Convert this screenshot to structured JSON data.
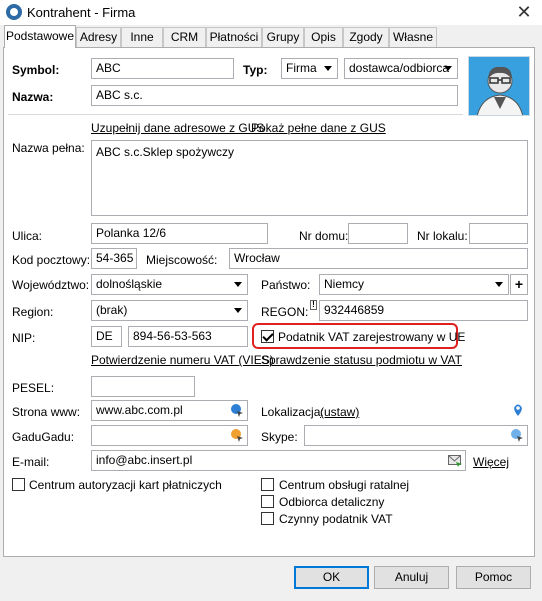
{
  "window": {
    "title": "Kontrahent - Firma",
    "close_glyph": "✕"
  },
  "tabs": [
    {
      "label": "Podstawowe"
    },
    {
      "label": "Adresy"
    },
    {
      "label": "Inne"
    },
    {
      "label": "CRM"
    },
    {
      "label": "Płatności"
    },
    {
      "label": "Grupy"
    },
    {
      "label": "Opis"
    },
    {
      "label": "Zgody"
    },
    {
      "label": "Własne"
    }
  ],
  "form": {
    "symbol_label": "Symbol:",
    "symbol_value": "ABC",
    "typ_label": "Typ:",
    "typ_value": "Firma",
    "relation_value": "dostawca/odbiorca",
    "nazwa_label": "Nazwa:",
    "nazwa_value": "ABC s.c.",
    "gus_link": "Uzupełnij dane adresowe z GUS",
    "gus_full_link": "Pokaż pełne dane z GUS",
    "pelna_label": "Nazwa pełna:",
    "pelna_value": "ABC s.c.Sklep spożywczy",
    "ulica_label": "Ulica:",
    "ulica_value": "Polanka  12/6",
    "nrdomu_label": "Nr domu:",
    "nrdomu_value": "",
    "nrlokalu_label": "Nr lokalu:",
    "nrlokalu_value": "",
    "kod_label": "Kod pocztowy:",
    "kod_value": "54-365",
    "miejsc_label": "Miejscowość:",
    "miejsc_value": "Wrocław",
    "woj_label": "Województwo:",
    "woj_value": "dolnośląskie",
    "panstwo_label": "Państwo:",
    "panstwo_value": "Niemcy",
    "panstwo_add": "+",
    "region_label": "Region:",
    "region_value": "(brak)",
    "regon_label": "REGON:",
    "regon_value": "932446859",
    "regon_marker": "!",
    "nip_label": "NIP:",
    "nip_prefix": "DE",
    "nip_value": "894-56-53-563",
    "vat_ue_label": "Podatnik VAT zarejestrowany w UE",
    "vies_link": "Potwierdzenie numeru VAT (VIES)",
    "status_link": "Sprawdzenie statusu podmiotu w VAT",
    "pesel_label": "PESEL:",
    "pesel_value": "",
    "www_label": "Strona www:",
    "www_value": "www.abc.com.pl",
    "lokalizacja_label": "Lokalizacja:",
    "lokalizacja_link": "(ustaw)",
    "gadu_label": "GaduGadu:",
    "gadu_value": "",
    "skype_label": "Skype:",
    "skype_value": "",
    "email_label": "E-mail:",
    "email_value": "info@abc.insert.pl",
    "wiecej_link": "Więcej"
  },
  "checkboxes": {
    "centrum_autoryzacji": {
      "label": "Centrum autoryzacji kart płatniczych",
      "checked": false
    },
    "centrum_obslugi": {
      "label": "Centrum obsługi ratalnej",
      "checked": false
    },
    "odbiorca_detaliczny": {
      "label": "Odbiorca detaliczny",
      "checked": false
    },
    "czynny_vat": {
      "label": "Czynny podatnik VAT",
      "checked": false
    },
    "vat_ue": {
      "checked": true
    }
  },
  "buttons": {
    "ok": "OK",
    "cancel": "Anuluj",
    "help": "Pomoc"
  },
  "colors": {
    "highlight": "#e02020",
    "link_icon": "#2d7fd3",
    "default_border": "#0078d7"
  }
}
